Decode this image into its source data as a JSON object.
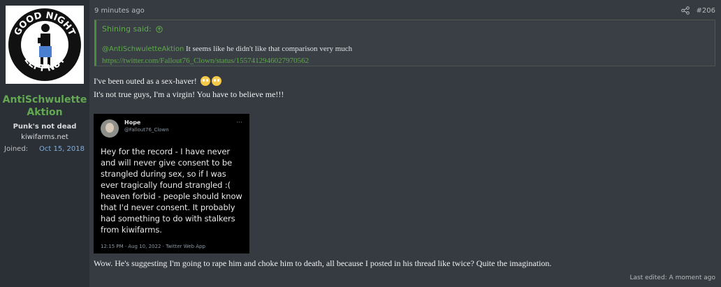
{
  "user": {
    "name": "AntiSchwulette Aktion",
    "title": "Punk's not dead",
    "site": "kiwifarms.net",
    "joined_label": "Joined:",
    "joined_value": "Oct 15, 2018",
    "avatar_text_top": "GOOD NIGHT",
    "avatar_text_bottom": "LEFT NUT"
  },
  "post": {
    "timestamp": "9 minutes ago",
    "number": "#206",
    "share_icon": "share-icon",
    "quote": {
      "author": "Shining said:",
      "mention": "@AntiSchwuletteAktion",
      "text": " It seems like he didn't like that comparison very much",
      "link": "https://twitter.com/Fallout76_Clown/status/1557412946027970562"
    },
    "line1": "I've been outed as a sex-haver!",
    "line2": "It's not true guys, I'm a virgin! You have to believe me!!!",
    "tweet": {
      "name": "Hope",
      "handle": "@Fallout76_Clown",
      "more": "···",
      "text": "Hey for the record - I have never and will never give consent to be strangled during sex, so if I was ever tragically found strangled :( heaven forbid - people should know that I'd never consent. It probably had something to do with stalkers from kiwifarms.",
      "meta": "12:15 PM · Aug 10, 2022 · Twitter Web App"
    },
    "closing": "Wow. He's suggesting I'm going to rape him and choke him to death, all because I posted in his thread like twice? Quite the imagination.",
    "last_edited": "Last edited: A moment ago"
  },
  "colors": {
    "accent_green": "#5faa4a",
    "username_green": "#63a852",
    "link_blue": "#7fb0e0",
    "page_bg": "#353b41",
    "sidebar_bg": "#2b3036"
  }
}
